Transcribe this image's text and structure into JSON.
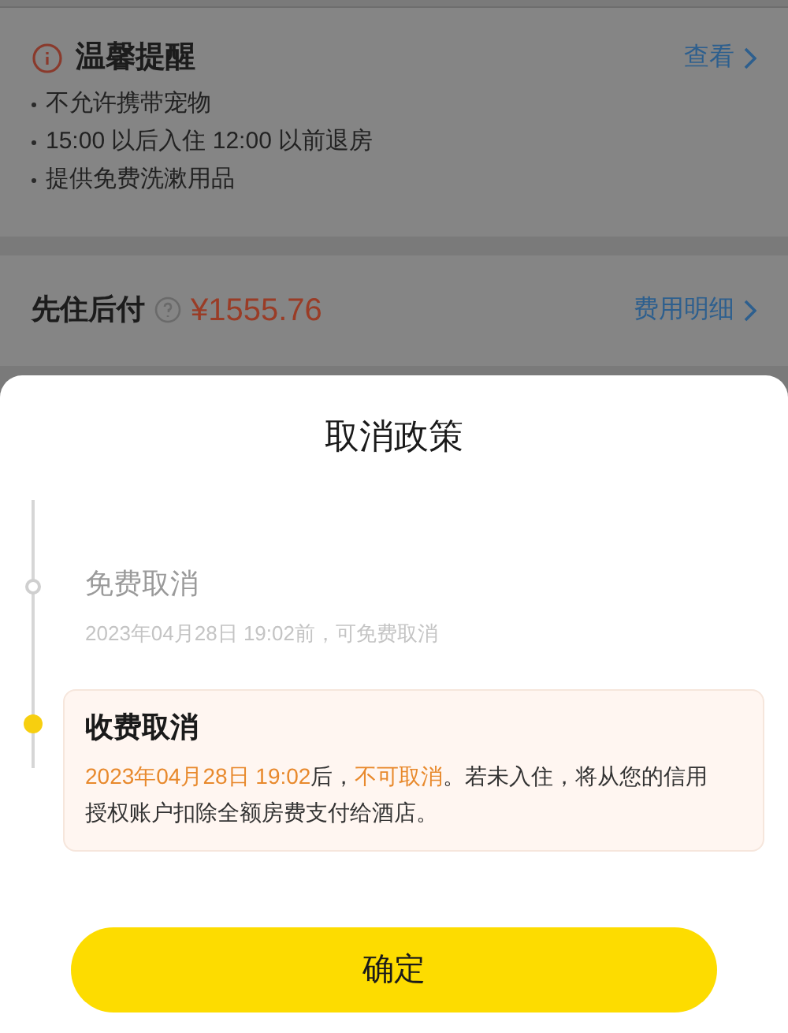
{
  "reminder": {
    "title": "温馨提醒",
    "link": "查看",
    "items": [
      "不允许携带宠物",
      "15:00 以后入住 12:00 以前退房",
      "提供免费洗漱用品"
    ]
  },
  "payment": {
    "label": "先住后付",
    "price": "¥1555.76",
    "link": "费用明细"
  },
  "sheet": {
    "title": "取消政策",
    "policies": [
      {
        "title": "免费取消",
        "active": false,
        "parts": [
          {
            "text": "2023年04月28日 19:02前，可免费取消",
            "emphasis": false
          }
        ]
      },
      {
        "title": "收费取消",
        "active": true,
        "parts": [
          {
            "text": "2023年04月28日 19:02",
            "emphasis": true
          },
          {
            "text": "后，",
            "emphasis": false
          },
          {
            "text": "不可取消",
            "emphasis": true
          },
          {
            "text": "。若未入住，将从您的信用授权账户扣除全额房费支付给酒店。",
            "emphasis": false
          }
        ]
      }
    ],
    "confirm": "确定"
  }
}
